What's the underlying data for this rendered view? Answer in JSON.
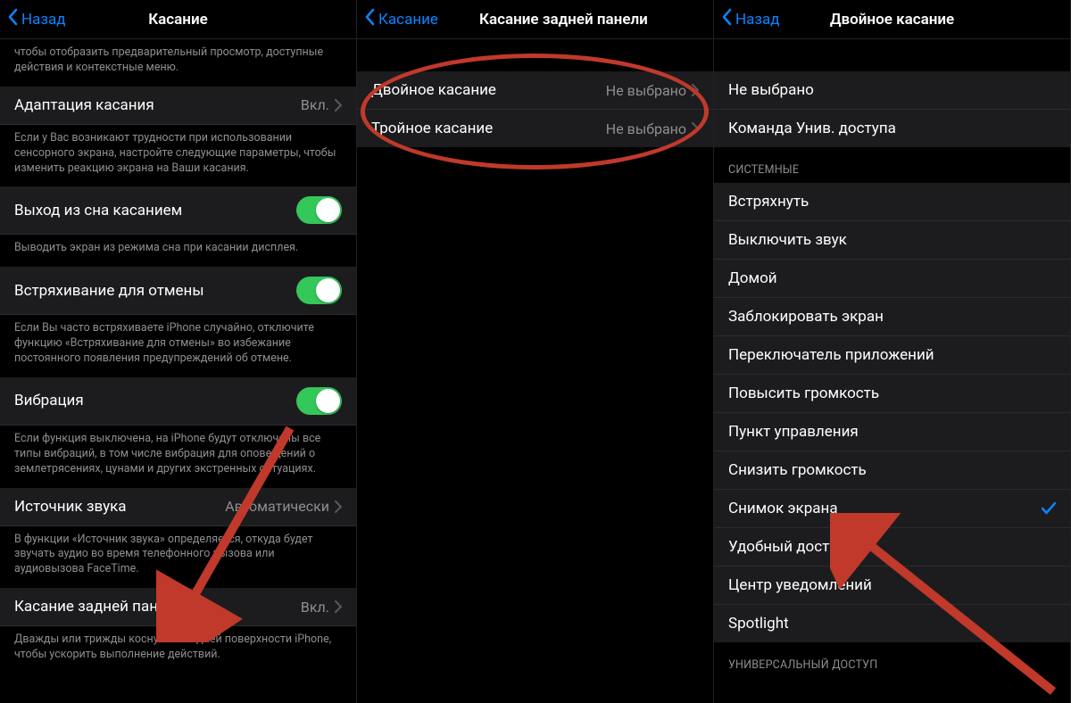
{
  "panel1": {
    "back": "Назад",
    "title": "Касание",
    "topFooter": "чтобы отобразить предварительный просмотр, доступные действия и контекстные меню.",
    "rows": {
      "adaptation": {
        "label": "Адаптация касания",
        "value": "Вкл."
      },
      "adaptationFooter": "Если у Вас возникают трудности при использовании сенсорного экрана, настройте следующие параметры, чтобы изменить реакцию экрана на Ваши касания.",
      "wake": {
        "label": "Выход из сна касанием"
      },
      "wakeFooter": "Выводить экран из режима сна при касании дисплея.",
      "shake": {
        "label": "Встряхивание для отмены"
      },
      "shakeFooter": "Если Вы часто встряхиваете iPhone случайно, отключите функцию «Встряхивание для отмены» во избежание постоянного появления предупреждений об отмене.",
      "vibration": {
        "label": "Вибрация"
      },
      "vibrationFooter": "Если функция выключена, на iPhone будут отключены все типы вибраций, в том числе вибрация для оповещений о землетрясениях, цунами и других экстренных ситуациях.",
      "audioSource": {
        "label": "Источник звука",
        "value": "Автоматически"
      },
      "audioSourceFooter": "В функции «Источник звука» определяется, откуда будет звучать аудио во время телефонного вызова или аудиовызова FaceTime.",
      "backTap": {
        "label": "Касание задней панели",
        "value": "Вкл."
      },
      "backTapFooter": "Дважды или трижды коснуться задней поверхности iPhone, чтобы ускорить выполнение действий."
    }
  },
  "panel2": {
    "back": "Касание",
    "title": "Касание задней панели",
    "rows": {
      "double": {
        "label": "Двойное касание",
        "value": "Не выбрано"
      },
      "triple": {
        "label": "Тройное касание",
        "value": "Не выбрано"
      }
    }
  },
  "panel3": {
    "back": "Назад",
    "title": "Двойное касание",
    "sectionTop": [
      "Не выбрано",
      "Команда Унив. доступа"
    ],
    "sectionSystemHeader": "СИСТЕМНЫЕ",
    "sectionSystem": [
      "Встряхнуть",
      "Выключить звук",
      "Домой",
      "Заблокировать экран",
      "Переключатель приложений",
      "Повысить громкость",
      "Пункт управления",
      "Снизить громкость",
      "Снимок экрана",
      "Удобный доступ",
      "Центр уведомлений",
      "Spotlight"
    ],
    "checkedIndex": 8,
    "sectionAccessHeader": "УНИВЕРСАЛЬНЫЙ ДОСТУП"
  }
}
